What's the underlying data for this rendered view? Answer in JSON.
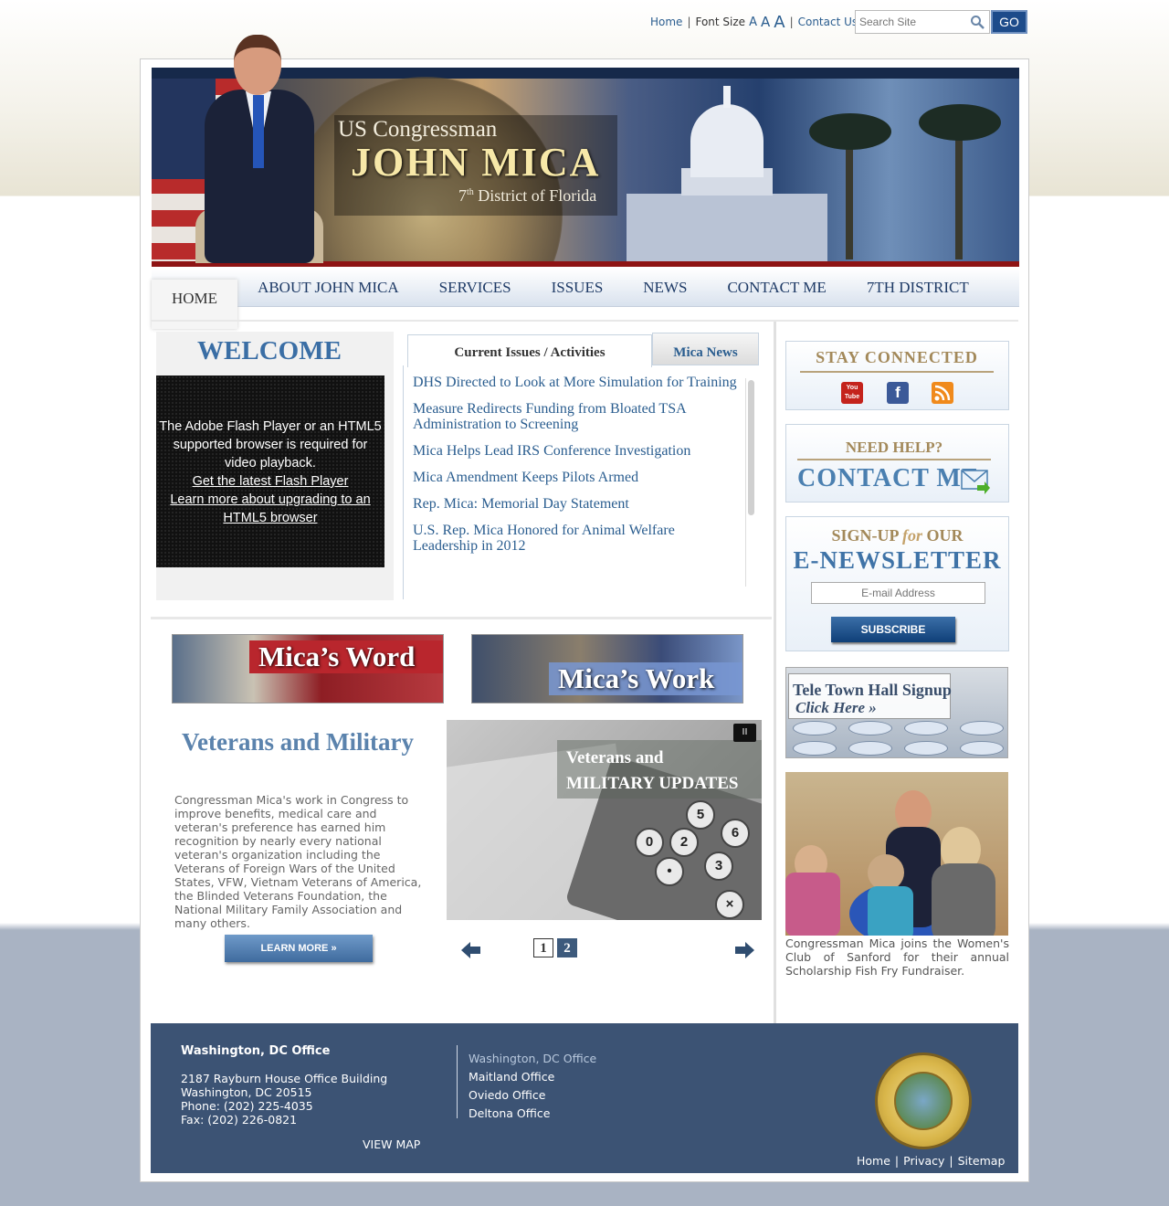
{
  "utility": {
    "home": "Home",
    "font_size_label": "Font Size",
    "font_a": "A",
    "contact": "Contact Us",
    "search_placeholder": "Search Site",
    "go": "GO"
  },
  "banner": {
    "line1": "US Congressman",
    "line2": "JOHN MICA",
    "line3_num": "7",
    "line3_sup": "th",
    "line3_rest": " District of Florida"
  },
  "nav": {
    "items": [
      "HOME",
      "ABOUT JOHN MICA",
      "SERVICES",
      "ISSUES",
      "NEWS",
      "CONTACT ME",
      "7TH DISTRICT"
    ]
  },
  "welcome": {
    "title": "WELCOME",
    "flash_msg": "The Adobe Flash Player or an HTML5 supported browser is required for video playback.",
    "flash_link1": "Get the latest Flash Player",
    "flash_link2": "Learn more about upgrading to an HTML5 browser"
  },
  "tabs": {
    "tab1": "Current Issues / Activities",
    "tab2": "Mica News",
    "news": [
      "DHS Directed to Look at More Simulation for Training",
      "Measure Redirects Funding from Bloated TSA Administration to Screening",
      "Mica Helps Lead IRS Conference Investigation",
      "Mica Amendment Keeps Pilots Armed",
      "Rep. Mica: Memorial Day Statement",
      "U.S. Rep. Mica Honored for Animal Welfare Leadership in 2012"
    ]
  },
  "promos": {
    "word": "Mica’s Word",
    "work": "Mica’s Work"
  },
  "feature": {
    "title": "Veterans and Military",
    "text": "Congressman Mica's work in Congress to improve benefits, medical care and veteran's preference has earned him recognition by nearly every national veteran's organization including the Veterans of Foreign Wars of the United States, VFW, Vietnam Veterans of America, the Blinded Veterans Foundation, the National Military Family Association and many others.",
    "learn_more": "LEARN MORE »",
    "slide_caption_l1": "Veterans and",
    "slide_caption_l2": "MILITARY UPDATES",
    "pause": "II",
    "pages": [
      "1",
      "2"
    ]
  },
  "sidebar": {
    "stay_connected": "STAY CONNECTED",
    "youtube": "You Tube",
    "facebook": "f",
    "need_help": "NEED HELP?",
    "contact_me": "CONTACT ME",
    "signup_pre": "SIGN-UP ",
    "signup_for": "for",
    "signup_post": " OUR",
    "enewsletter": "E-NEWSLETTER",
    "email_placeholder": "E-mail Address",
    "subscribe": "SUBSCRIBE",
    "tele_l1": "Tele Town Hall Signup",
    "tele_l2": "Click Here »",
    "photo_caption": "Congressman Mica joins the Women's Club of Sanford for their annual Scholarship Fish Fry Fundraiser."
  },
  "footer": {
    "office_heading": "Washington, DC Office",
    "addr1": "2187 Rayburn House Office Building",
    "addr2": "Washington, DC 20515",
    "phone": "Phone: (202) 225-4035",
    "fax": "Fax: (202) 226-0821",
    "view_map": "VIEW MAP",
    "offices": [
      "Washington, DC Office",
      "Maitland Office",
      "Oviedo Office",
      "Deltona Office"
    ],
    "links": [
      "Home",
      "Privacy",
      "Sitemap"
    ]
  }
}
